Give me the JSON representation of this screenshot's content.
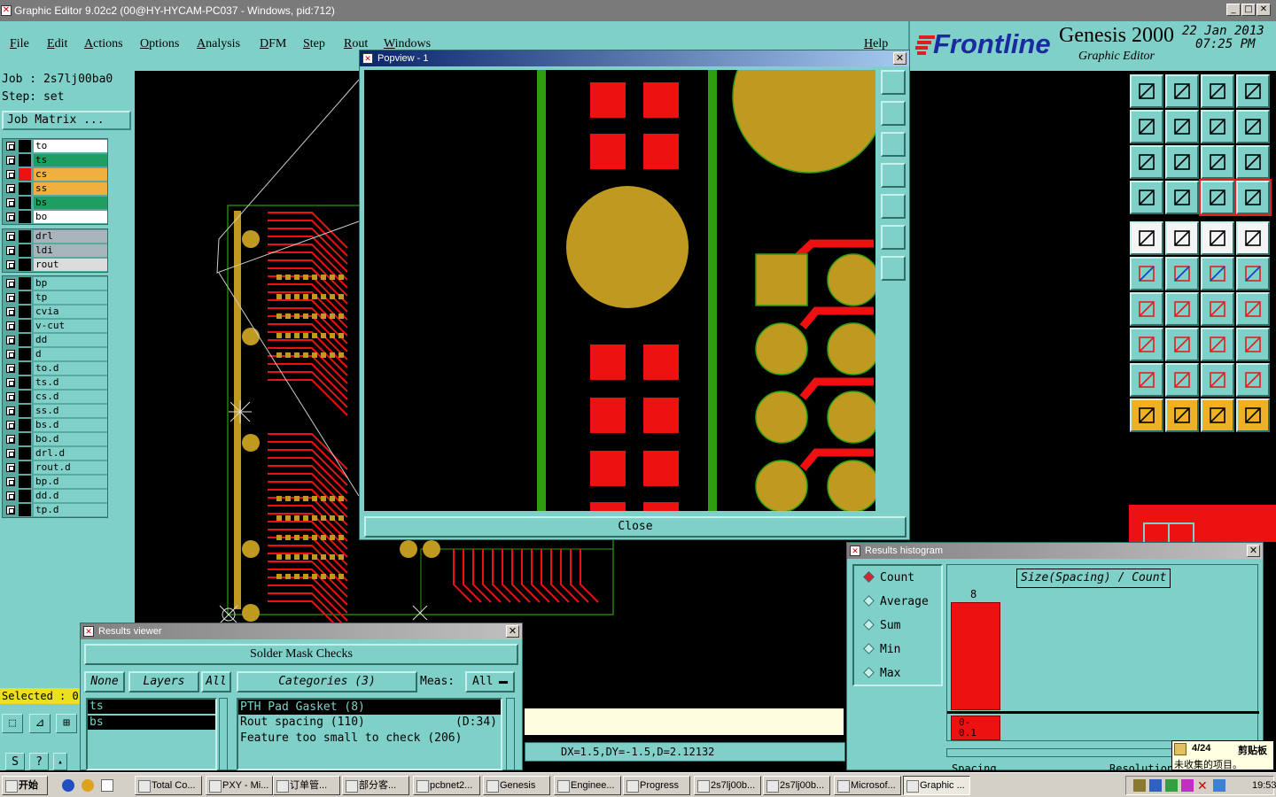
{
  "window": {
    "title": "Graphic Editor 9.02c2 (00@HY-HYCAM-PC037 - Windows, pid:712)"
  },
  "menu": [
    "File",
    "Edit",
    "Actions",
    "Options",
    "Analysis",
    "DFM",
    "Step",
    "Rout",
    "Windows"
  ],
  "menu_help": "Help",
  "logo": {
    "brand": "Frontline",
    "product": "Genesis 2000",
    "subtitle": "Graphic Editor",
    "date": "22 Jan 2013",
    "time": "07:25 PM"
  },
  "job": {
    "job_line": "Job : 2s7lj00ba0",
    "step_line": "Step: set",
    "matrix_button": "Job Matrix ..."
  },
  "layers": {
    "group1": [
      {
        "name": "to",
        "color": "#ffffff",
        "bg": "#ffffff"
      },
      {
        "name": "ts",
        "color": "#1f9e62",
        "bg": "#1f9e62"
      },
      {
        "name": "cs",
        "color": "#ee1111",
        "bg": "#f0b040"
      },
      {
        "name": "ss",
        "color": "#f0b040",
        "bg": "#f0b040"
      },
      {
        "name": "bs",
        "color": "#1f9e62",
        "bg": "#1f9e62"
      },
      {
        "name": "bo",
        "color": "#ffffff",
        "bg": "#ffffff"
      }
    ],
    "group2": [
      {
        "name": "drl",
        "bg": "#a8b4bc"
      },
      {
        "name": "ldi",
        "bg": "#a8b4bc"
      },
      {
        "name": "rout",
        "bg": "#dcdcdc"
      }
    ],
    "group3": [
      "bp",
      "tp",
      "cvia",
      "v-cut",
      "dd",
      "d",
      "to.d",
      "ts.d",
      "cs.d",
      "ss.d",
      "bs.d",
      "bo.d",
      "drl.d",
      "rout.d",
      "bp.d",
      "dd.d",
      "tp.d"
    ]
  },
  "selected": "Selected : 0",
  "popview": {
    "title": "Popview - 1",
    "close_label": "Close"
  },
  "status": {
    "readout": "DX=1.5,DY=-1.5,D=2.12132"
  },
  "histogram": {
    "title": "Results histogram",
    "options": [
      "Count",
      "Average",
      "Sum",
      "Min",
      "Max"
    ],
    "selected_option": "Count",
    "header": "Size(Spacing) / Count",
    "bar_value": "8",
    "range_label": "0-\n0.1",
    "spacing_tab": "Spacing",
    "resolution_tab": "Resolution"
  },
  "results_viewer": {
    "title": "Results viewer",
    "header": "Solder Mask Checks",
    "none_btn": "None",
    "layers_btn": "Layers",
    "all_btn": "All",
    "categories_btn": "Categories (3)",
    "meas_label": "Meas:",
    "meas_value": "All",
    "layer_items": [
      "ts",
      "bs"
    ],
    "categories": [
      {
        "name": "PTH Pad Gasket (8)",
        "extra": ""
      },
      {
        "name": "Rout spacing (110)",
        "extra": "(D:34)"
      },
      {
        "name": "Feature too small to check (206)",
        "extra": ""
      }
    ]
  },
  "clipboard_tip": {
    "count": "4/24",
    "title": "剪贴板",
    "text": "未收集的项目。"
  },
  "taskbar": {
    "start": "开始",
    "tasks": [
      "Total Co...",
      "PXY - Mi...",
      "订单管...",
      "部分客...",
      "pcbnet2...",
      "Genesis",
      "Enginee...",
      "Progress",
      "2s7lj00b...",
      "2s7lj00b...",
      "Microsof...",
      "Graphic ..."
    ],
    "clock": "19:53"
  },
  "colors": {
    "teal": "#7fd0c8",
    "pad": "#c09a20",
    "trace": "#ee1111",
    "green": "#2e9e10"
  }
}
